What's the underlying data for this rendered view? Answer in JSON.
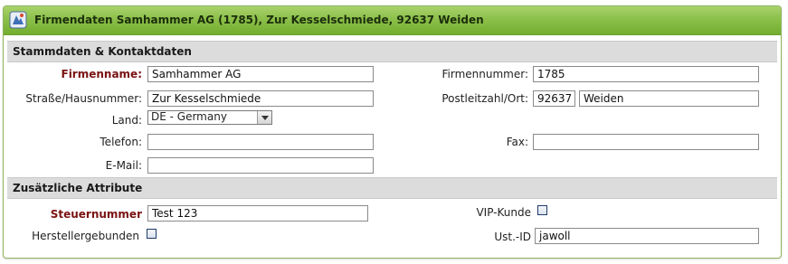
{
  "header": {
    "title": "Firmendaten Samhammer AG (1785), Zur Kesselschmiede, 92637 Weiden",
    "icon": "company-logo-icon"
  },
  "sections": {
    "stammdaten": "Stammdaten & Kontaktdaten",
    "zusatz": "Zusätzliche Attribute"
  },
  "fields": {
    "firmenname": {
      "label": "Firmenname:",
      "value": "Samhammer AG"
    },
    "strasse": {
      "label": "Straße/Hausnummer:",
      "value": "Zur Kesselschmiede"
    },
    "land": {
      "label": "Land:",
      "value": "DE - Germany"
    },
    "telefon": {
      "label": "Telefon:",
      "value": ""
    },
    "email": {
      "label": "E-Mail:",
      "value": ""
    },
    "firmennummer": {
      "label": "Firmennummer:",
      "value": "1785"
    },
    "plz_ort": {
      "label": "Postleitzahl/Ort:",
      "plz": "92637",
      "ort": "Weiden"
    },
    "fax": {
      "label": "Fax:",
      "value": ""
    },
    "steuernummer": {
      "label": "Steuernummer",
      "value": "Test 123"
    },
    "herstellergebunden": {
      "label": "Herstellergebunden",
      "checked": false
    },
    "vip_kunde": {
      "label": "VIP-Kunde",
      "checked": false
    },
    "ust_id": {
      "label": "Ust.-ID",
      "value": "jawoll"
    }
  },
  "colors": {
    "header_green": "#8cc04a",
    "required_label": "#7a1212",
    "section_bg": "#dcdcdc"
  }
}
